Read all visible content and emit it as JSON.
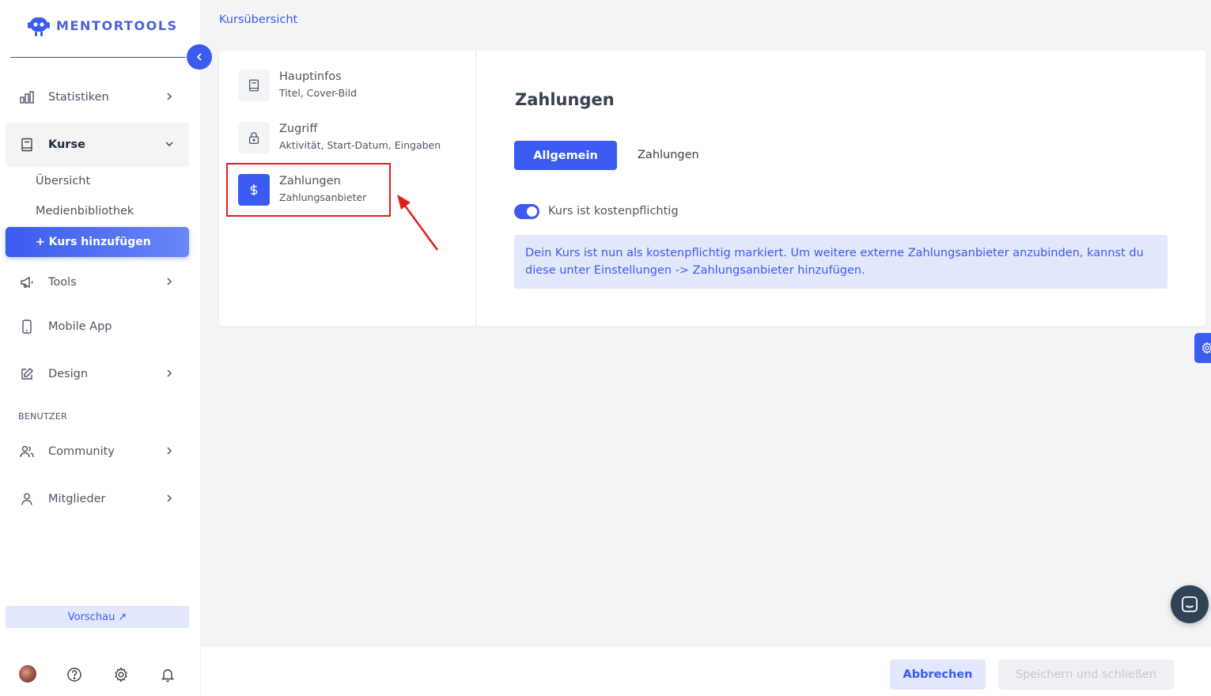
{
  "brand": {
    "name": "MENTORTOOLS",
    "color": "#3b5bf0"
  },
  "sidebar": {
    "items": [
      {
        "label": "Statistiken",
        "icon": "bar-chart-icon"
      },
      {
        "label": "Kurse",
        "icon": "book-icon"
      },
      {
        "label": "Tools",
        "icon": "megaphone-icon"
      },
      {
        "label": "Mobile App",
        "icon": "phone-icon"
      },
      {
        "label": "Design",
        "icon": "pencil-icon"
      },
      {
        "label": "Community",
        "icon": "users-icon"
      },
      {
        "label": "Mitglieder",
        "icon": "user-icon"
      }
    ],
    "sub_items": [
      "Übersicht",
      "Medienbibliothek"
    ],
    "add_button": "+ Kurs hinzufügen",
    "section_label": "BENUTZER",
    "preview": "Vorschau",
    "preview_icon": "↗"
  },
  "breadcrumb": "Kursübersicht",
  "steps": [
    {
      "title": "Hauptinfos",
      "subtitle": "Titel, Cover-Bild",
      "icon": "book-icon"
    },
    {
      "title": "Zugriff",
      "subtitle": "Aktivität, Start-Datum, Eingaben",
      "icon": "lock-icon"
    },
    {
      "title": "Zahlungen",
      "subtitle": "Zahlungsanbieter",
      "icon": "dollar-icon"
    }
  ],
  "main": {
    "heading": "Zahlungen",
    "tabs": [
      {
        "label": "Allgemein",
        "active": true
      },
      {
        "label": "Zahlungen",
        "active": false
      }
    ],
    "toggle": {
      "label": "Kurs ist kostenpflichtig",
      "on": true
    },
    "alert": "Dein Kurs ist nun als kostenpflichtig markiert. Um weitere externe Zahlungsanbieter anzubinden, kannst du diese unter Einstellungen -> Zahlungsanbieter hinzufügen."
  },
  "footer": {
    "cancel": "Abbrechen",
    "save": "Speichern und schließen"
  }
}
